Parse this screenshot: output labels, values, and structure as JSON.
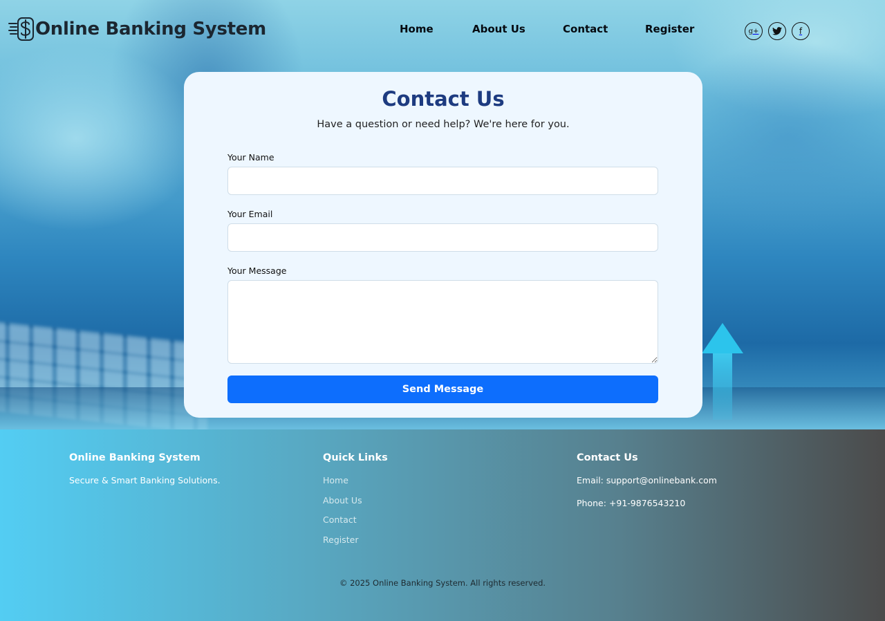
{
  "brand": {
    "name": "Online Banking System",
    "logo_icon": "dollar-coin-speed-icon"
  },
  "nav": {
    "items": [
      {
        "label": "Home"
      },
      {
        "label": "About Us"
      },
      {
        "label": "Contact"
      },
      {
        "label": "Register"
      }
    ]
  },
  "social": [
    {
      "icon": "google-plus-icon",
      "glyph": "g+"
    },
    {
      "icon": "twitter-icon",
      "glyph": ""
    },
    {
      "icon": "facebook-icon",
      "glyph": "f"
    }
  ],
  "contact_form": {
    "title": "Contact Us",
    "subtitle": "Have a question or need help? We're here for you.",
    "name_label": "Your Name",
    "name_value": "",
    "email_label": "Your Email",
    "email_value": "",
    "message_label": "Your Message",
    "message_value": "",
    "submit_label": "Send Message"
  },
  "footer": {
    "about": {
      "title": "Online Banking System",
      "tagline": "Secure & Smart Banking Solutions."
    },
    "quick_links": {
      "title": "Quick Links",
      "links": [
        {
          "label": "Home"
        },
        {
          "label": "About Us"
        },
        {
          "label": "Contact"
        },
        {
          "label": "Register"
        }
      ]
    },
    "contact": {
      "title": "Contact Us",
      "email": "Email: support@onlinebank.com",
      "phone": "Phone: +91-9876543210"
    },
    "copyright": "© 2025 Online Banking System. All rights reserved."
  },
  "colors": {
    "primary_button": "#0d6efd",
    "title_blue": "#1d3b80",
    "card_bg": "#eef7ff"
  }
}
